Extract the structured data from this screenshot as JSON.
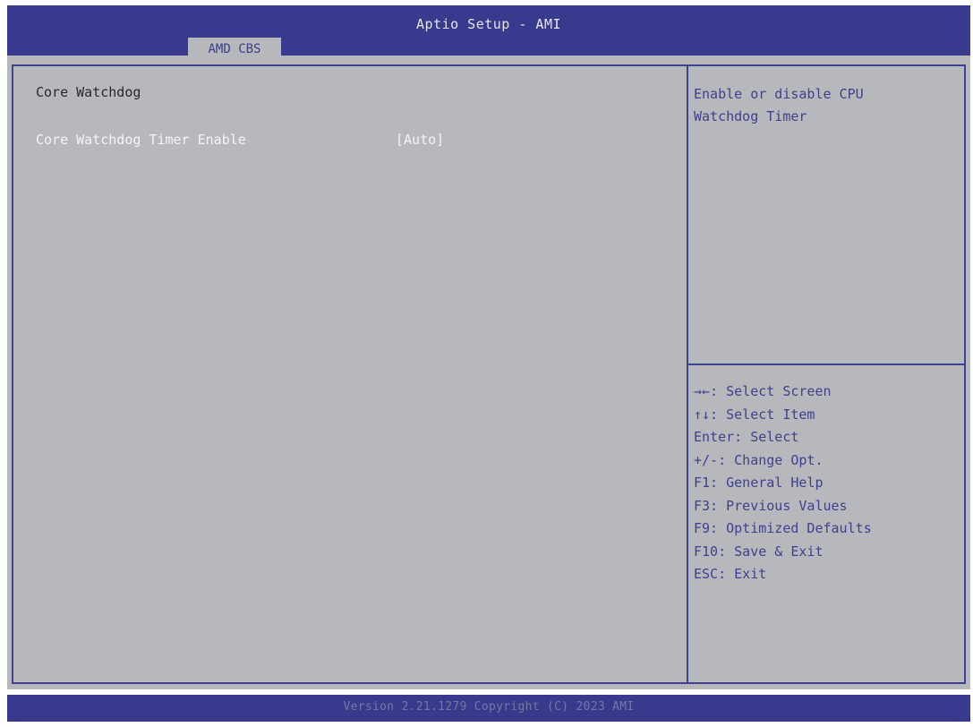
{
  "header": {
    "title": "Aptio Setup - AMI",
    "tabs": [
      {
        "label": "AMD CBS",
        "active": true
      }
    ]
  },
  "main": {
    "section_title": "Core Watchdog",
    "settings": [
      {
        "label": "Core Watchdog Timer Enable",
        "value": "[Auto]"
      }
    ]
  },
  "help": {
    "lines": [
      "Enable or disable CPU",
      "Watchdog Timer"
    ]
  },
  "keys": [
    "→←: Select Screen",
    "↑↓: Select Item",
    "Enter: Select",
    "+/-: Change Opt.",
    "F1: General Help",
    "F3: Previous Values",
    "F9: Optimized Defaults",
    "F10: Save & Exit",
    "ESC: Exit"
  ],
  "footer": {
    "version": "Version 2.21.1279 Copyright (C) 2023 AMI"
  },
  "colors": {
    "header_bg": "#383a8e",
    "panel_bg": "#b7b8bc",
    "accent": "#3e418e",
    "item_text": "#f4f4f8",
    "title_text": "#28282e"
  }
}
